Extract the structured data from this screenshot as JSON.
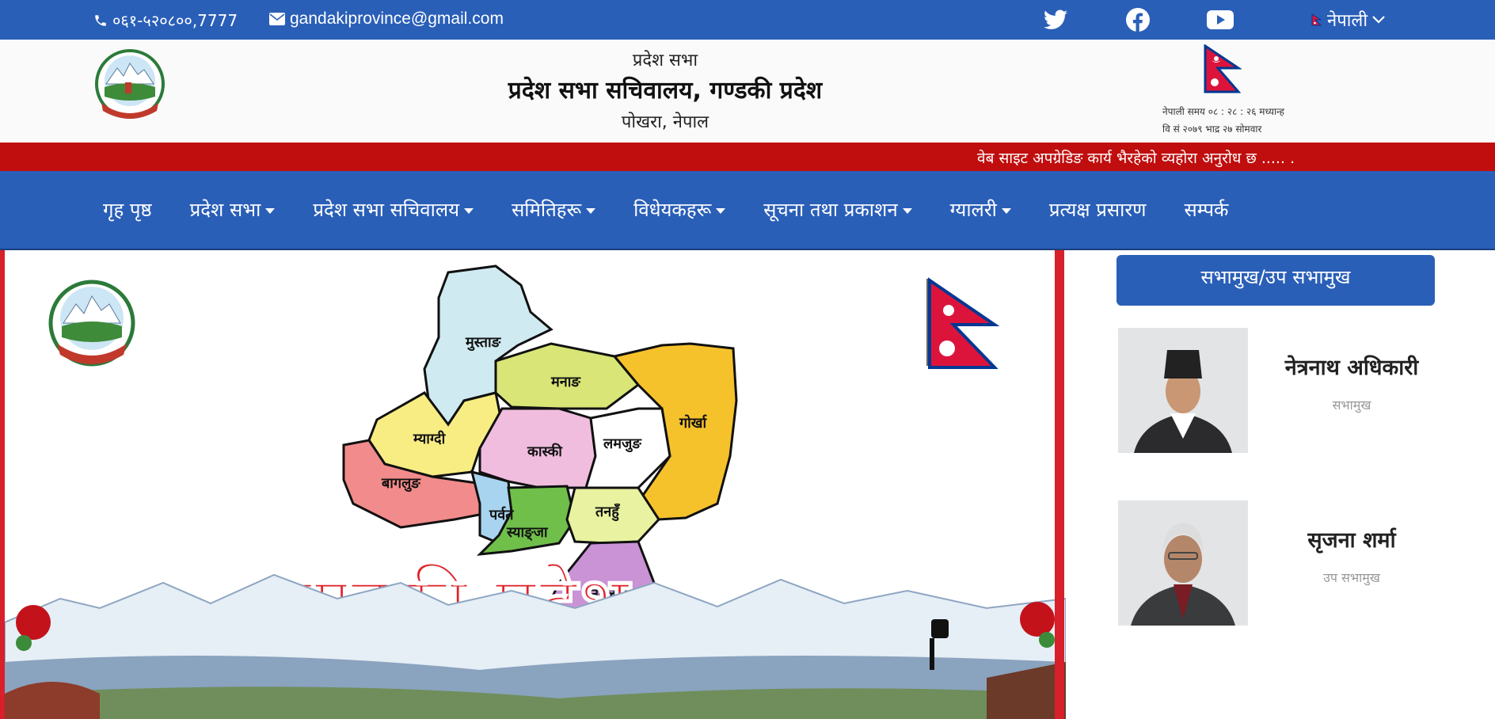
{
  "topbar": {
    "phone": "०६१-५२०८००,7777",
    "email": "gandakiprovince@gmail.com",
    "social": [
      "twitter-icon",
      "facebook-icon",
      "youtube-icon"
    ],
    "language": "नेपाली"
  },
  "header": {
    "line1": "प्रदेश सभा",
    "line2": "प्रदेश सभा सचिवालय, गण्डकी प्रदेश",
    "line3": "पोखरा, नेपाल",
    "time": "नेपाली समय ०८ : २८ : २६ मध्यान्ह",
    "date": "वि सं २०७९ भाद्र २७ सोमवार"
  },
  "marquee": "वेब साइट अपग्रेडिङ कार्य भैरहेको व्यहोरा अनुरोध छ ..... .",
  "nav": [
    {
      "label": "गृह पृष्ठ",
      "dropdown": false
    },
    {
      "label": "प्रदेश सभा",
      "dropdown": true
    },
    {
      "label": "प्रदेश सभा सचिवालय",
      "dropdown": true
    },
    {
      "label": "समितिहरू",
      "dropdown": true
    },
    {
      "label": "विधेयकहरू",
      "dropdown": true
    },
    {
      "label": "सूचना तथा प्रकाशन",
      "dropdown": true
    },
    {
      "label": "ग्यालरी",
      "dropdown": true
    },
    {
      "label": "प्रत्यक्ष प्रसारण",
      "dropdown": false
    },
    {
      "label": "सम्पर्क",
      "dropdown": false
    }
  ],
  "hero": {
    "title": "गण्डकी प्रदेश",
    "districts": [
      "मुस्ताङ",
      "मनाङ",
      "म्याग्दी",
      "गोर्खा",
      "कास्की",
      "लमजुङ",
      "बागलुङ",
      "पर्वत",
      "स्याङ्जा",
      "तनहुँ",
      "नवलपुर"
    ]
  },
  "sidebar": {
    "heading": "सभामुख/उप सभामुख",
    "people": [
      {
        "name": "नेत्रनाथ अधिकारी",
        "role": "सभामुख"
      },
      {
        "name": "सृजना शर्मा",
        "role": "उप सभामुख"
      }
    ]
  },
  "colors": {
    "primary": "#2a5fb8",
    "accent": "#c00d0d"
  }
}
